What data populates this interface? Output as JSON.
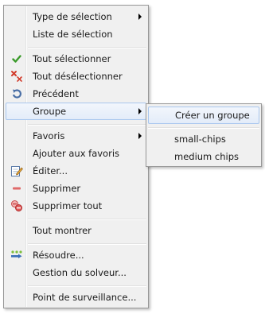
{
  "menu": {
    "items": [
      {
        "label": "Type de sélection",
        "icon": null,
        "submenu": true
      },
      {
        "label": "Liste de sélection",
        "icon": null,
        "submenu": false
      },
      {
        "label": "Tout sélectionner",
        "icon": "green-check-icon",
        "submenu": false
      },
      {
        "label": "Tout désélectionner",
        "icon": "red-x-icon",
        "submenu": false
      },
      {
        "label": "Précédent",
        "icon": "undo-arrow-icon",
        "submenu": false
      },
      {
        "label": "Groupe",
        "icon": null,
        "submenu": true,
        "highlighted": true
      },
      {
        "label": "Favoris",
        "icon": null,
        "submenu": true
      },
      {
        "label": "Ajouter aux favoris",
        "icon": null,
        "submenu": false
      },
      {
        "label": "Éditer...",
        "icon": "edit-page-icon",
        "submenu": false
      },
      {
        "label": "Supprimer",
        "icon": "minus-icon",
        "submenu": false
      },
      {
        "label": "Supprimer tout",
        "icon": "delete-all-icon",
        "submenu": false
      },
      {
        "label": "Tout montrer",
        "icon": null,
        "submenu": false
      },
      {
        "label": "Résoudre...",
        "icon": "solver-icon",
        "submenu": false
      },
      {
        "label": "Gestion du solveur...",
        "icon": null,
        "submenu": false
      },
      {
        "label": "Point de surveillance...",
        "icon": null,
        "submenu": false
      }
    ]
  },
  "submenu": {
    "items": [
      {
        "label": "Créer un groupe",
        "highlighted": true
      },
      {
        "label": "small-chips"
      },
      {
        "label": "medium chips"
      }
    ]
  },
  "colors": {
    "menu_bg": "#f0f0f0",
    "highlight_border": "#a8c6ee",
    "check_green": "#3a9a2a",
    "x_red": "#d23c2c",
    "undo_blue": "#4a6fa5"
  }
}
